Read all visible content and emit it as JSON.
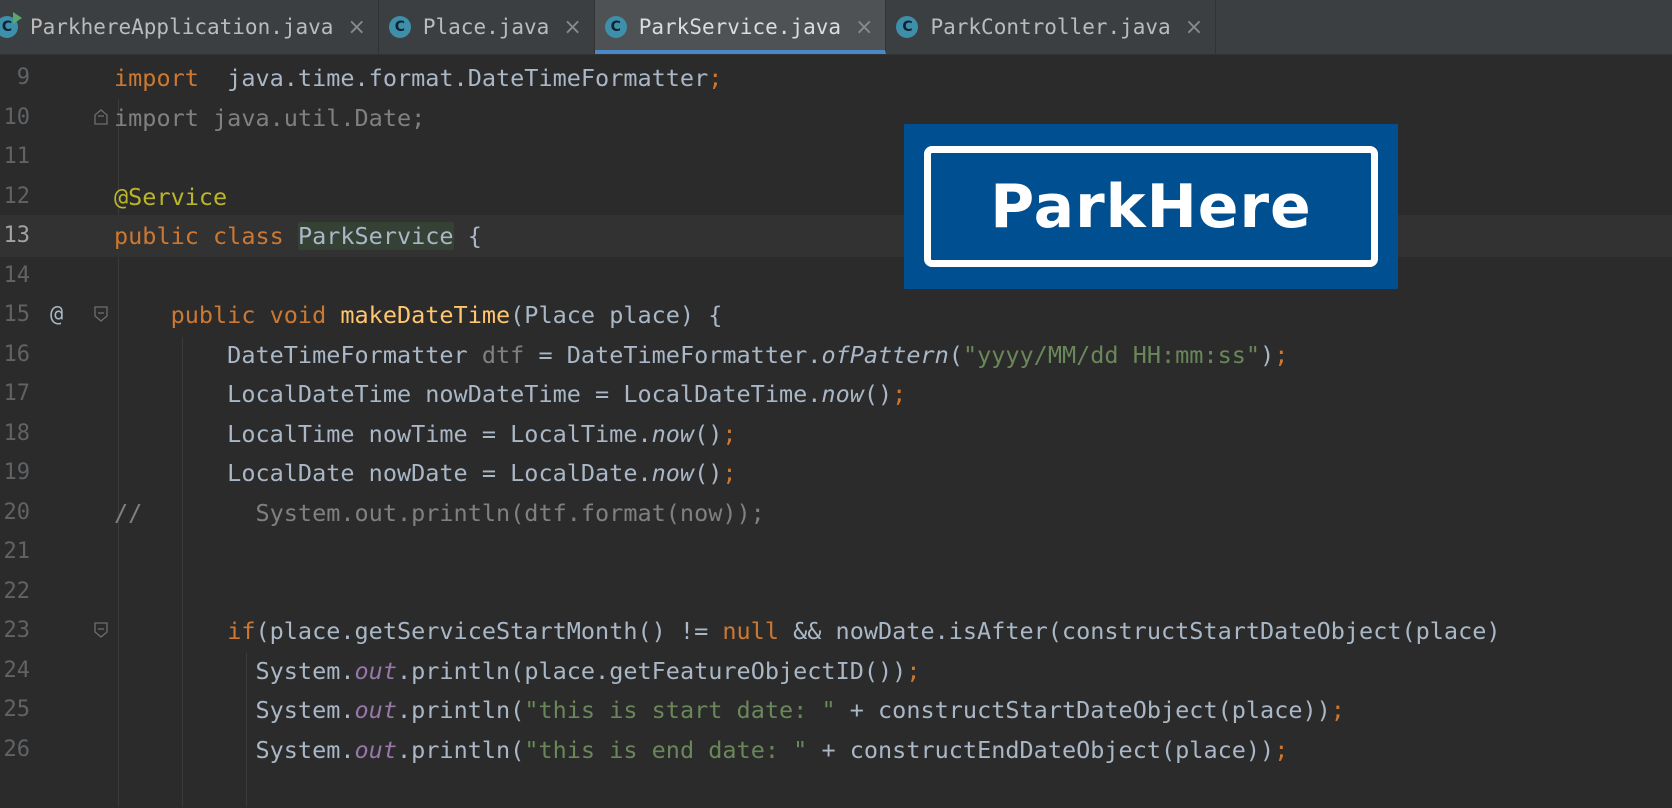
{
  "tabs": [
    {
      "label": "ParkhereApplication.java",
      "active": false,
      "icon": "class-run-icon"
    },
    {
      "label": "Place.java",
      "active": false,
      "icon": "class-icon"
    },
    {
      "label": "ParkService.java",
      "active": true,
      "icon": "class-icon"
    },
    {
      "label": "ParkController.java",
      "active": false,
      "icon": "class-icon"
    }
  ],
  "tab_close_glyph": "×",
  "class_icon_glyph": "C",
  "gutter_at_glyph": "@",
  "logo_text": "ParkHere",
  "colors": {
    "keyword": "#cc7832",
    "annotation": "#bbb529",
    "method_decl": "#ffc66d",
    "string": "#6a8759",
    "text": "#a9b7c6",
    "comment": "#808080",
    "static_field": "#9876aa",
    "logo_bg": "#004f91"
  },
  "lines": [
    {
      "n": "9",
      "tokens": [
        [
          "kw",
          "import"
        ],
        [
          "",
          "  java.time.format.DateTimeFormatter"
        ],
        [
          "kw",
          ";"
        ]
      ]
    },
    {
      "n": "10",
      "tokens": [
        [
          "gray",
          "import java.util.Date;"
        ]
      ]
    },
    {
      "n": "11",
      "tokens": []
    },
    {
      "n": "12",
      "tokens": [
        [
          "ann",
          "@Service"
        ]
      ]
    },
    {
      "n": "13",
      "tokens": [
        [
          "kw",
          "public class "
        ],
        [
          "hl",
          "ParkService"
        ],
        [
          "",
          " {"
        ]
      ]
    },
    {
      "n": "14",
      "tokens": []
    },
    {
      "n": "15",
      "tokens": [
        [
          "",
          "    "
        ],
        [
          "kw",
          "public void "
        ],
        [
          "fn",
          "makeDateTime"
        ],
        [
          "",
          "(Place place) {"
        ]
      ]
    },
    {
      "n": "16",
      "tokens": [
        [
          "",
          "        DateTimeFormatter "
        ],
        [
          "gray",
          "dtf"
        ],
        [
          "",
          " = DateTimeFormatter."
        ],
        [
          "it",
          "ofPattern"
        ],
        [
          "",
          "("
        ],
        [
          "str",
          "\"yyyy/MM/dd HH:mm:ss\""
        ],
        [
          "",
          ")"
        ],
        [
          "kw",
          ";"
        ]
      ]
    },
    {
      "n": "17",
      "tokens": [
        [
          "",
          "        LocalDateTime nowDateTime = LocalDateTime."
        ],
        [
          "it",
          "now"
        ],
        [
          "",
          "()"
        ],
        [
          "kw",
          ";"
        ]
      ]
    },
    {
      "n": "18",
      "tokens": [
        [
          "",
          "        LocalTime nowTime = LocalTime."
        ],
        [
          "it",
          "now"
        ],
        [
          "",
          "()"
        ],
        [
          "kw",
          ";"
        ]
      ]
    },
    {
      "n": "19",
      "tokens": [
        [
          "",
          "        LocalDate nowDate = LocalDate."
        ],
        [
          "it",
          "now"
        ],
        [
          "",
          "()"
        ],
        [
          "kw",
          ";"
        ]
      ]
    },
    {
      "n": "20",
      "tokens": [
        [
          "gray",
          "//        System.out.println(dtf.format(now));"
        ]
      ]
    },
    {
      "n": "21",
      "tokens": []
    },
    {
      "n": "22",
      "tokens": []
    },
    {
      "n": "23",
      "tokens": [
        [
          "",
          "        "
        ],
        [
          "kw",
          "if"
        ],
        [
          "",
          "(place.getServiceStartMonth() != "
        ],
        [
          "kw",
          "null"
        ],
        [
          "",
          " && nowDate.isAfter(constructStartDateObject(place)"
        ]
      ]
    },
    {
      "n": "24",
      "tokens": [
        [
          "",
          "          System."
        ],
        [
          "field",
          "out"
        ],
        [
          "",
          ".println(place.getFeatureObjectID())"
        ],
        [
          "kw",
          ";"
        ]
      ]
    },
    {
      "n": "25",
      "tokens": [
        [
          "",
          "          System."
        ],
        [
          "field",
          "out"
        ],
        [
          "",
          ".println("
        ],
        [
          "str",
          "\"this is start date: \""
        ],
        [
          "",
          " + constructStartDateObject(place))"
        ],
        [
          "kw",
          ";"
        ]
      ]
    },
    {
      "n": "26",
      "tokens": [
        [
          "",
          "          System."
        ],
        [
          "field",
          "out"
        ],
        [
          "",
          ".println("
        ],
        [
          "str",
          "\"this is end date: \""
        ],
        [
          "",
          " + constructEndDateObject(place))"
        ],
        [
          "kw",
          ";"
        ]
      ]
    }
  ]
}
